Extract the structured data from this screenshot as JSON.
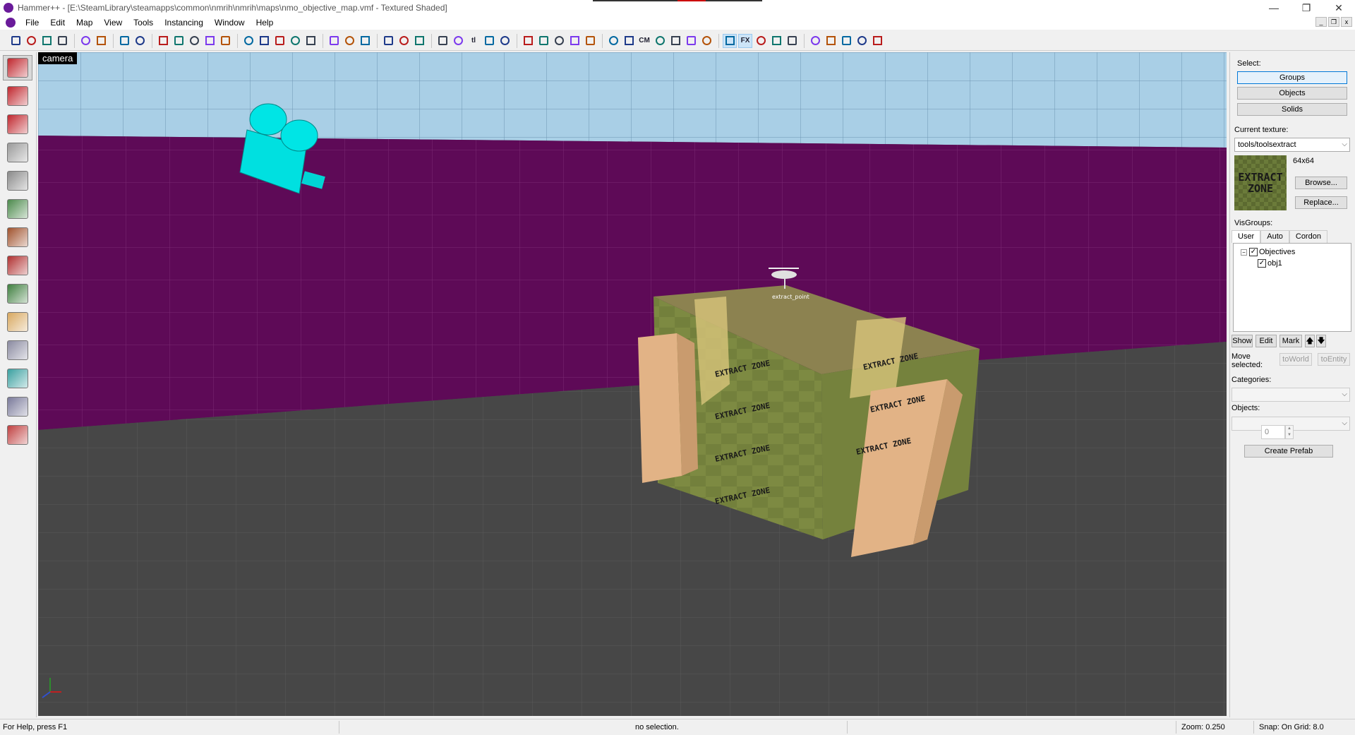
{
  "window": {
    "title": "Hammer++ - [E:\\SteamLibrary\\steamapps\\common\\nmrih\\nmrih\\maps\\nmo_objective_map.vmf - Textured Shaded]",
    "controls": [
      "—",
      "❐",
      "✕"
    ]
  },
  "menu": {
    "items": [
      "File",
      "Edit",
      "Map",
      "View",
      "Tools",
      "Instancing",
      "Window",
      "Help"
    ],
    "mdi_controls": [
      "_",
      "❐",
      "x"
    ]
  },
  "toolbar": {
    "buttons": [
      "grid",
      "grid-dots",
      "grid-small",
      "grid-large",
      "group",
      "ungroup",
      "undo",
      "redo",
      "cut-carve",
      "hollow",
      "texture-lock",
      "texture-lock-scale",
      "ignore-groups",
      "brush-red-1",
      "brush-red-2",
      "brush-red-3",
      "brush-red-4",
      "brush-red-5",
      "scissors",
      "copy",
      "paste",
      "hazard-1",
      "hazard-2",
      "hazard-3",
      "select-box",
      "select-cursor",
      "tl",
      "align",
      "flip",
      "face-tool",
      "path",
      "entity",
      "vertex",
      "clip",
      "carve",
      "ambient",
      "cm",
      "sphere",
      "nodraw",
      "loop",
      "bullseye",
      "target",
      "fx",
      "hint",
      "alt-hint",
      "prefab",
      "sort-1",
      "sort-2",
      "sort-3",
      "sort-4",
      "sort-5"
    ],
    "text_buttons": {
      "tl": "tl",
      "cm": "CM",
      "fx": "FX"
    }
  },
  "tools": [
    "selection-tool",
    "magnify-tool",
    "camera-tool",
    "entity-tool",
    "block-tool",
    "texture-application-tool",
    "apply-current-texture-tool",
    "decal-tool",
    "overlay-tool",
    "clipping-tool",
    "vertex-tool",
    "path-tool",
    "sprinkle-tool",
    "texture-browser-tool"
  ],
  "viewport": {
    "label": "camera",
    "entity_label": "extract_point",
    "texture_text": [
      "EXTRACT",
      "ZONE"
    ]
  },
  "panel": {
    "select_label": "Select:",
    "select_buttons": [
      "Groups",
      "Objects",
      "Solids"
    ],
    "current_texture_label": "Current texture:",
    "current_texture": "tools/toolsextract",
    "texture_size": "64x64",
    "texture_thumb_text": [
      "EXTRACT",
      "ZONE"
    ],
    "browse_button": "Browse...",
    "replace_button": "Replace...",
    "visgroups_label": "VisGroups:",
    "tabs": [
      "User",
      "Auto",
      "Cordon"
    ],
    "tree": [
      {
        "label": "Objectives",
        "checked": true,
        "expander": "−"
      },
      {
        "label": "obj1",
        "checked": true
      }
    ],
    "check_mark": "✓",
    "vis_buttons": [
      "Show",
      "Edit",
      "Mark"
    ],
    "vis_arrows": [
      "🡅",
      "🡇"
    ],
    "move_selected_label": "Move selected:",
    "to_world": "toWorld",
    "to_entity": "toEntity",
    "categories_label": "Categories:",
    "objects_label": "Objects:",
    "count_value": "0",
    "create_prefab": "Create Prefab"
  },
  "status": {
    "help": "For Help, press F1",
    "selection": "no selection.",
    "zoom": "Zoom: 0.250",
    "snap": "Snap: On Grid: 8.0"
  },
  "colors": {
    "sky": "#a9cfe6",
    "wall": "#5e0a57",
    "floor": "#4a4a4a",
    "crate": "#7d8a42",
    "camera_model": "#00e5e5",
    "pillar": "#d9a876"
  }
}
